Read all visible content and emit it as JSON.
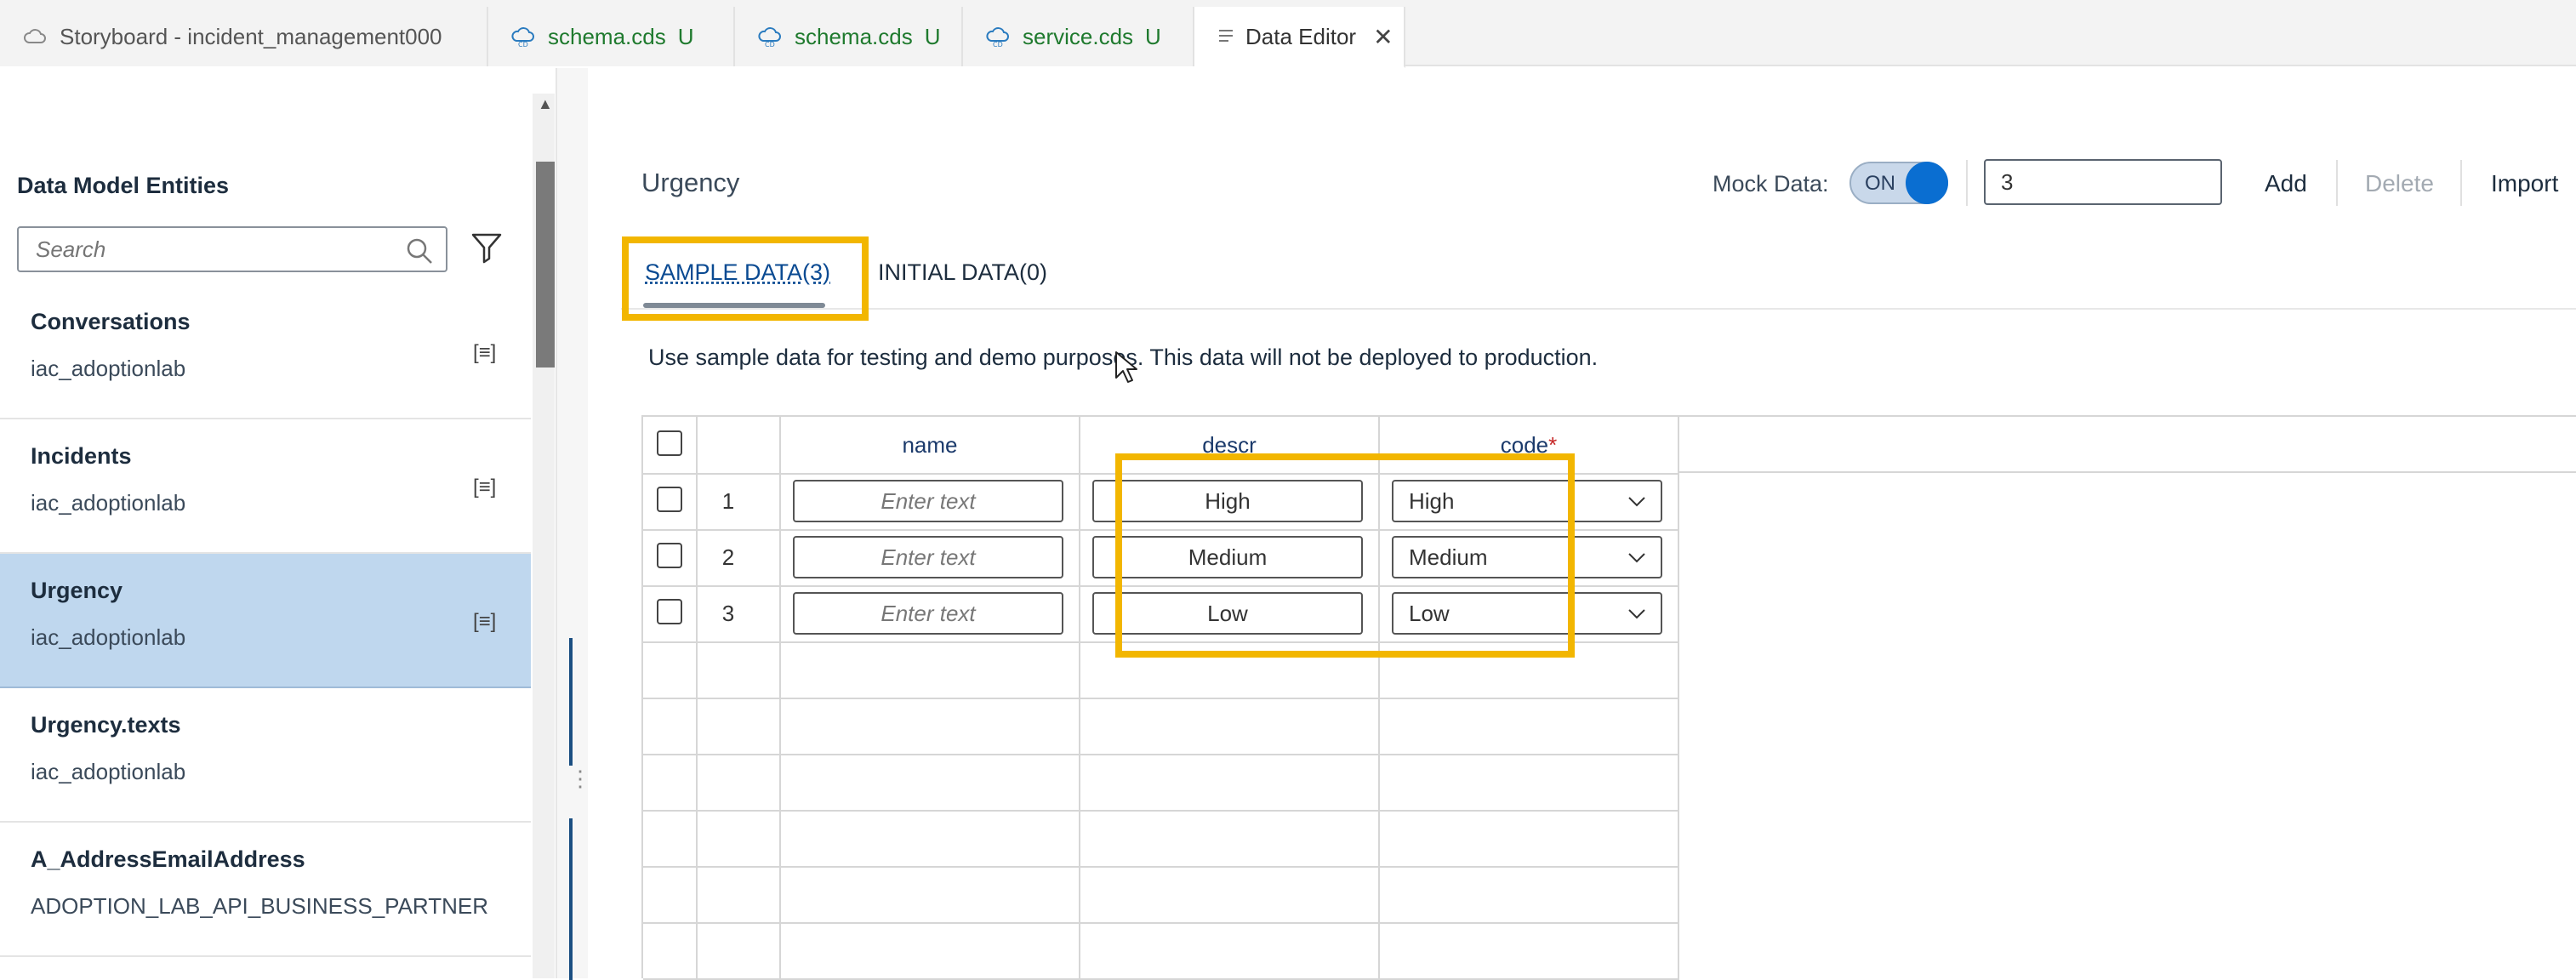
{
  "tabs": [
    {
      "label": "Storyboard - incident_management000",
      "badge": "",
      "icon": "cloud-icon"
    },
    {
      "label": "schema.cds",
      "badge": "U",
      "icon": "cds-file-icon"
    },
    {
      "label": "schema.cds",
      "badge": "U",
      "icon": "cds-file-icon"
    },
    {
      "label": "service.cds",
      "badge": "U",
      "icon": "cds-file-icon"
    },
    {
      "label": "Data Editor",
      "badge": "",
      "icon": "document-icon",
      "active": true
    }
  ],
  "sidebar": {
    "title": "Data Model Entities",
    "search_placeholder": "Search",
    "entities": [
      {
        "name": "Conversations",
        "namespace": "iac_adoptionlab"
      },
      {
        "name": "Incidents",
        "namespace": "iac_adoptionlab"
      },
      {
        "name": "Urgency",
        "namespace": "iac_adoptionlab",
        "selected": true
      },
      {
        "name": "Urgency.texts",
        "namespace": "iac_adoptionlab"
      },
      {
        "name": "A_AddressEmailAddress",
        "namespace": "ADOPTION_LAB_API_BUSINESS_PARTNER"
      }
    ]
  },
  "editor": {
    "entity_title": "Urgency",
    "mock_data_label": "Mock Data:",
    "mock_toggle": "ON",
    "mock_count": "3",
    "add_label": "Add",
    "delete_label": "Delete",
    "import_label": "Import",
    "data_tabs": [
      {
        "label": "SAMPLE DATA(3)",
        "active": true
      },
      {
        "label": "INITIAL DATA(0)",
        "active": false
      }
    ],
    "hint": "Use sample data for testing and demo purposes. This data will not be deployed to production.",
    "columns": [
      "name",
      "descr",
      "code"
    ],
    "required_marker": "*",
    "name_placeholder": "Enter text",
    "rows": [
      {
        "num": "1",
        "descr": "High",
        "code": "High"
      },
      {
        "num": "2",
        "descr": "Medium",
        "code": "Medium"
      },
      {
        "num": "3",
        "descr": "Low",
        "code": "Low"
      }
    ]
  },
  "colors": {
    "accent": "#0a6ed1",
    "highlight": "#f2b600",
    "selected_row": "#bfd7ee",
    "badge_green": "#1f7a2e"
  }
}
